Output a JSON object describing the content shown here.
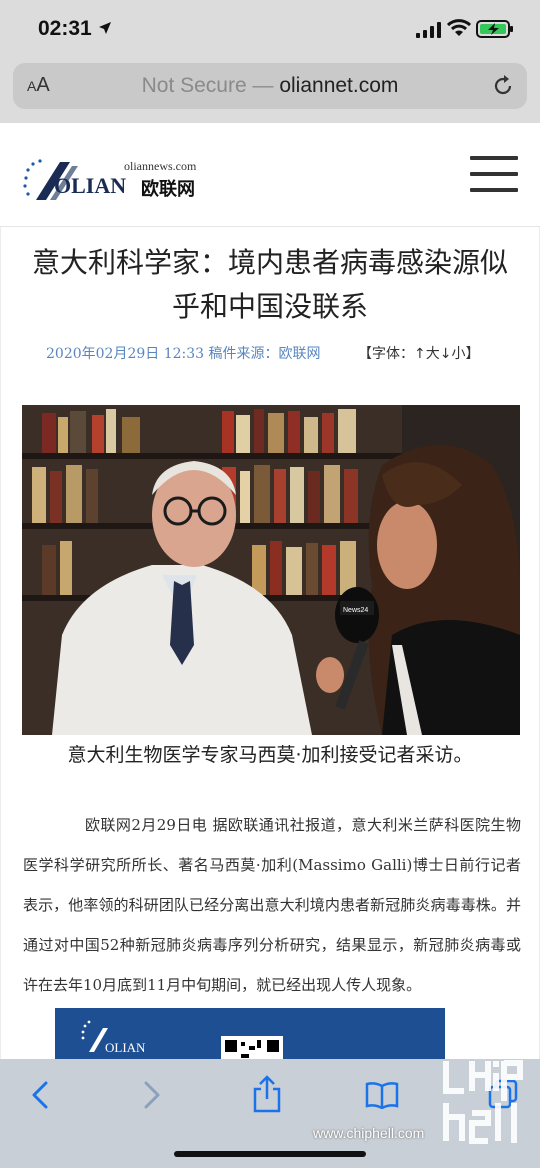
{
  "status": {
    "time": "02:31"
  },
  "browser": {
    "aa_label_small": "A",
    "aa_label": "A",
    "url_prefix": "Not Secure — ",
    "url_domain": "oliannet.com"
  },
  "site": {
    "logo_domain": "oliannews.com",
    "logo_word": "OLIAN",
    "logo_cn": "欧联网"
  },
  "article": {
    "title": "意大利科学家：境内患者病毒感染源似乎和中国没联系",
    "meta": "2020年02月29日 12:33 稿件来源：欧联网",
    "font_controls": "【字体：↑大↓小】",
    "caption": "意大利生物医学专家马西莫·加利接受记者采访。",
    "body": "欧联网2月29日电 据欧联通讯社报道，意大利米兰萨科医院生物医学科学研究所所长、著名马西莫·加利(Massimo Galli)博士日前行记者表示，他率领的科研团队已经分离出意大利境内患者新冠肺炎病毒毒株。并通过对中国52种新冠肺炎病毒序列分析研究，结果显示，新冠肺炎病毒或许在去年10月底到11月中旬期间，就已经出现人传人现象。",
    "photo_mic_label": "News24",
    "ad_label": "OLIAN"
  },
  "watermark": "www.chiphell.com",
  "colors": {
    "chrome_gray": "#dcdcdc",
    "bottom_bar": "#c9cfd7",
    "ios_blue": "#1a73e8",
    "meta_blue": "#5a86c0",
    "logo_navy": "#1a2c54"
  }
}
